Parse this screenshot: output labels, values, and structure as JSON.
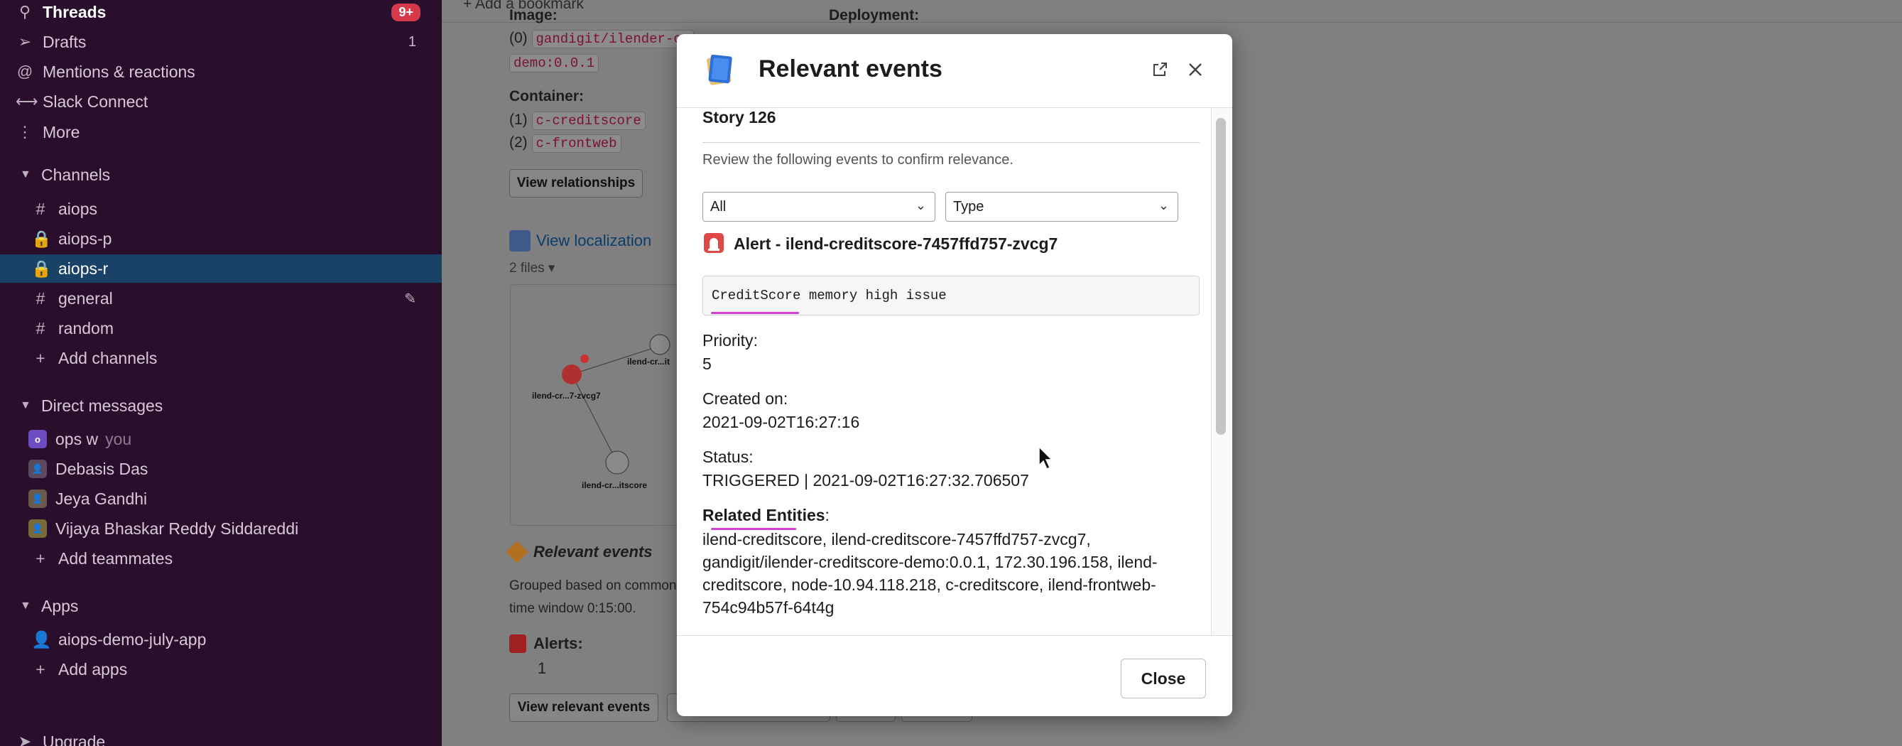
{
  "sidebar": {
    "nav": [
      {
        "icon": "threads-icon",
        "label": "Threads",
        "badge": "9+"
      },
      {
        "icon": "drafts-icon",
        "label": "Drafts",
        "count": "1"
      },
      {
        "icon": "mentions-icon",
        "label": "Mentions & reactions"
      },
      {
        "icon": "slack-connect-icon",
        "label": "Slack Connect"
      },
      {
        "icon": "more-icon",
        "label": "More"
      }
    ],
    "channels_header": "Channels",
    "channels": [
      {
        "prefix": "#",
        "label": "aiops"
      },
      {
        "prefix": "lock",
        "label": "aiops-p"
      },
      {
        "prefix": "lock",
        "label": "aiops-r",
        "selected": true
      },
      {
        "prefix": "#",
        "label": "general"
      },
      {
        "prefix": "#",
        "label": "random"
      }
    ],
    "add_channels": "Add channels",
    "dm_header": "Direct messages",
    "dms": [
      {
        "label": "ops w",
        "suffix": "you"
      },
      {
        "label": "Debasis Das"
      },
      {
        "label": "Jeya Gandhi"
      },
      {
        "label": "Vijaya Bhaskar Reddy Siddareddi"
      }
    ],
    "add_teammates": "Add teammates",
    "apps_header": "Apps",
    "apps": [
      {
        "label": "aiops-demo-july-app"
      }
    ],
    "add_apps": "Add apps",
    "upgrade": "Upgrade"
  },
  "main": {
    "add_bookmark": "Add a bookmark",
    "image_label": "Image:",
    "deployment_label": "Deployment:",
    "image_idx": "(0)",
    "image_value_1": "gandigit/ilender-cr",
    "image_value_2": "demo:0.0.1",
    "container_label": "Container:",
    "container_items": [
      {
        "idx": "(1)",
        "value": "c-creditscore"
      },
      {
        "idx": "(2)",
        "value": "c-frontweb"
      }
    ],
    "view_relationships": "View relationships",
    "view_localization": "View localization",
    "files": "2 files",
    "graph_nodes": [
      "ilend-cr...7-zvcg7",
      "ilend-cr...it",
      "ilend-cr...itscore"
    ],
    "relevant_events_title": "Relevant events",
    "grouped_text_1": "Grouped based on common",
    "grouped_text_2": "time window 0:15:00.",
    "alerts_label": "Alerts:",
    "alerts_count": "1",
    "view_relevant_events": "View relevant events"
  },
  "modal": {
    "title": "Relevant events",
    "story": "Story 126",
    "intro": "Review the following events to confirm relevance.",
    "filter_value": "All",
    "type_value": "Type",
    "alert_title": "Alert - ilend-creditscore-7457ffd757-zvcg7",
    "code": "CreditScore memory high issue",
    "priority_label": "Priority",
    "priority_value": "5",
    "created_label": "Created on",
    "created_value": "2021-09-02T16:27:16",
    "status_label": "Status",
    "status_value": "TRIGGERED | 2021-09-02T16:27:32.706507",
    "entities_label": "Related Entities",
    "entities_value": "ilend-creditscore, ilend-creditscore-7457ffd757-zvcg7, gandigit/ilender-creditscore-demo:0.0.1, 172.30.196.158, ilend-creditscore, node-10.94.118.218, c-creditscore, ilend-frontweb-754c94b57f-64t4g",
    "colon": ":",
    "close_label": "Close"
  },
  "colors": {
    "sidebar_bg": "#2a0f2c",
    "selected_bg": "#1a4166",
    "badge": "#d63a4a",
    "underline": "#d43fd6"
  }
}
